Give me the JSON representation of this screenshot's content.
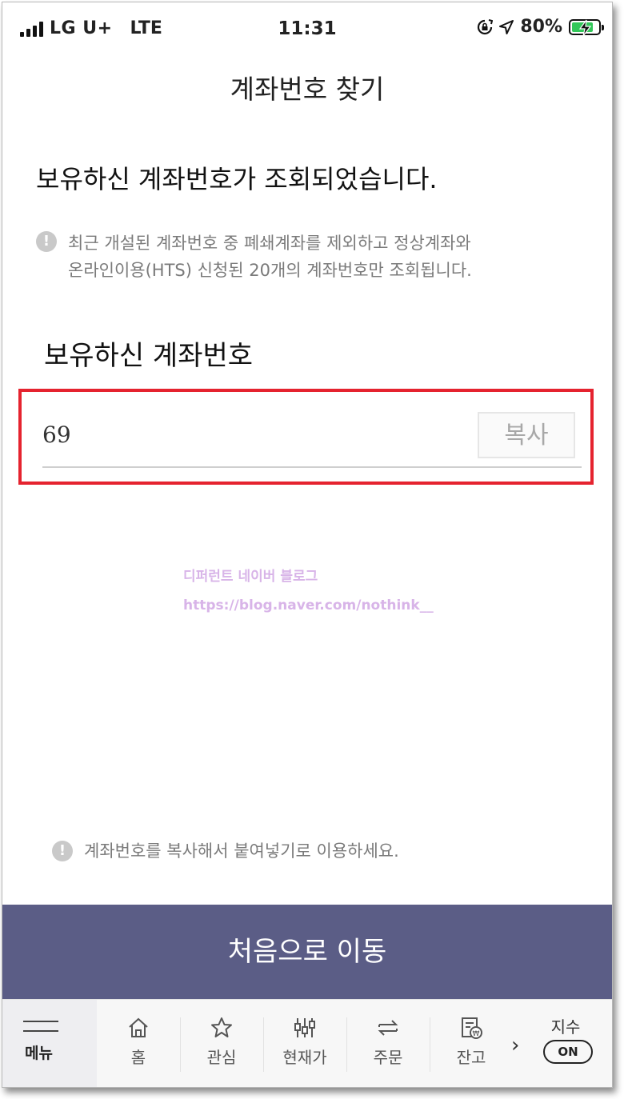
{
  "status_bar": {
    "carrier": "LG U+",
    "network": "LTE",
    "time": "11:31",
    "battery": "80%"
  },
  "page": {
    "title": "계좌번호 찾기",
    "result_heading": "보유하신 계좌번호가 조회되었습니다.",
    "info_lines": [
      "최근 개설된 계좌번호 중 폐쇄계좌를 제외하고 정상계좌와",
      "온라인이용(HTS) 신청된 20개의 계좌번호만 조회됩니다."
    ],
    "section_label": "보유하신 계좌번호",
    "account_value": "69",
    "copy_label": "복사",
    "watermark": {
      "line1": "디퍼런트 네이버 블로그",
      "line2": "https://blog.naver.com/nothink__"
    },
    "copy_hint": "계좌번호를 복사해서 붙여넣기로 이용하세요.",
    "primary_button": "처음으로 이동"
  },
  "tabbar": {
    "menu": "메뉴",
    "items": [
      {
        "label": "홈",
        "icon": "home-icon"
      },
      {
        "label": "관심",
        "icon": "star-icon"
      },
      {
        "label": "현재가",
        "icon": "candlestick-icon"
      },
      {
        "label": "주문",
        "icon": "swap-arrows-icon"
      },
      {
        "label": "잔고",
        "icon": "balance-doc-icon"
      }
    ],
    "index_label": "지수",
    "index_toggle": "ON"
  },
  "colors": {
    "primary_button_bg": "#5b5d86",
    "highlight_border": "#e5232f",
    "battery_fill": "#32c759"
  }
}
